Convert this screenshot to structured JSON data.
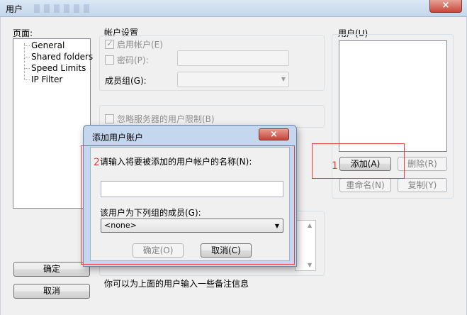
{
  "main_window": {
    "title": "用户",
    "close_glyph": "×"
  },
  "pages_panel": {
    "label": "页面:",
    "items": [
      "General",
      "Shared folders",
      "Speed Limits",
      "IP Filter"
    ]
  },
  "account_settings": {
    "group_label": "帐户设置",
    "enable_account_label": "启用帐户(E)",
    "enable_account_checked": true,
    "password_label": "密码(P):",
    "password_checked": false,
    "password_value": "",
    "member_group_label": "成员组(G):",
    "member_group_value": ""
  },
  "bypass_limits": {
    "label": "忽略服务器的用户限制(B)",
    "checked": false
  },
  "users_panel": {
    "label": "用户(U)",
    "users": [],
    "add_button": "添加(A)",
    "delete_button": "删除(R)",
    "rename_button": "重命名(N)",
    "copy_button": "复制(Y)"
  },
  "bottom_buttons": {
    "ok": "确定",
    "cancel": "取消"
  },
  "comment_hint": "你可以为上面的用户输入一些备注信息",
  "annotations": {
    "one": "1",
    "two": "2",
    "color": "#e8413c"
  },
  "dialog": {
    "title": "添加用户账户",
    "close_glyph": "×",
    "prompt_label": "请输入将要被添加的用户帐户的名称(N):",
    "name_value": "",
    "group_label": "该用户为下列组的成员(G):",
    "group_value": "<none>",
    "ok_button": "确定(O)",
    "cancel_button": "取消(C)"
  }
}
